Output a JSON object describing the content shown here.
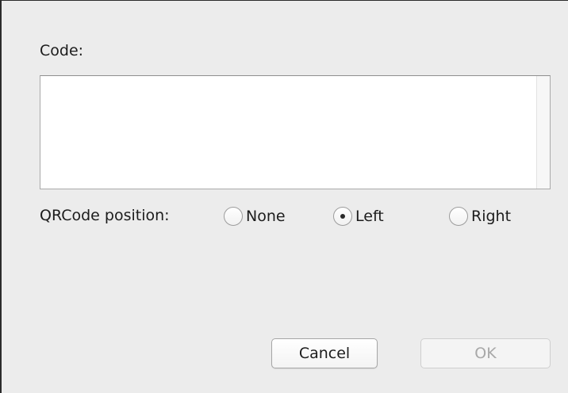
{
  "dialog": {
    "code_label": "Code:",
    "code_value": "",
    "position_label": "QRCode position:",
    "position_options": [
      {
        "label": "None",
        "selected": false
      },
      {
        "label": "Left",
        "selected": true
      },
      {
        "label": "Right",
        "selected": false
      }
    ],
    "cancel_label": "Cancel",
    "ok_label": "OK",
    "ok_enabled": false
  }
}
